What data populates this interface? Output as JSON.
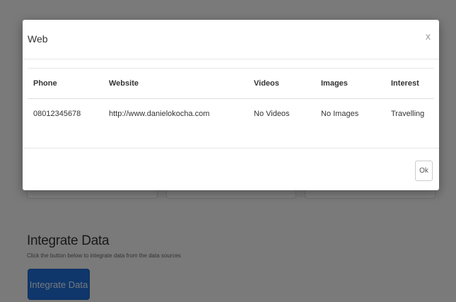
{
  "modal": {
    "title": "Web",
    "close": "x",
    "ok_label": "Ok",
    "table": {
      "headers": [
        "Phone",
        "Website",
        "Videos",
        "Images",
        "Interest"
      ],
      "rows": [
        [
          "08012345678",
          "http://www.danielokocha.com",
          "No Videos",
          "No Images",
          "Travelling"
        ]
      ]
    }
  },
  "integrate": {
    "title": "Integrate Data",
    "description": "Click the button below to integrate data from the data sources",
    "button_label": "Integrate Data"
  },
  "colors": {
    "primary_button": "#1f6fd6",
    "backdrop": "rgba(0,0,0,0.5)"
  }
}
